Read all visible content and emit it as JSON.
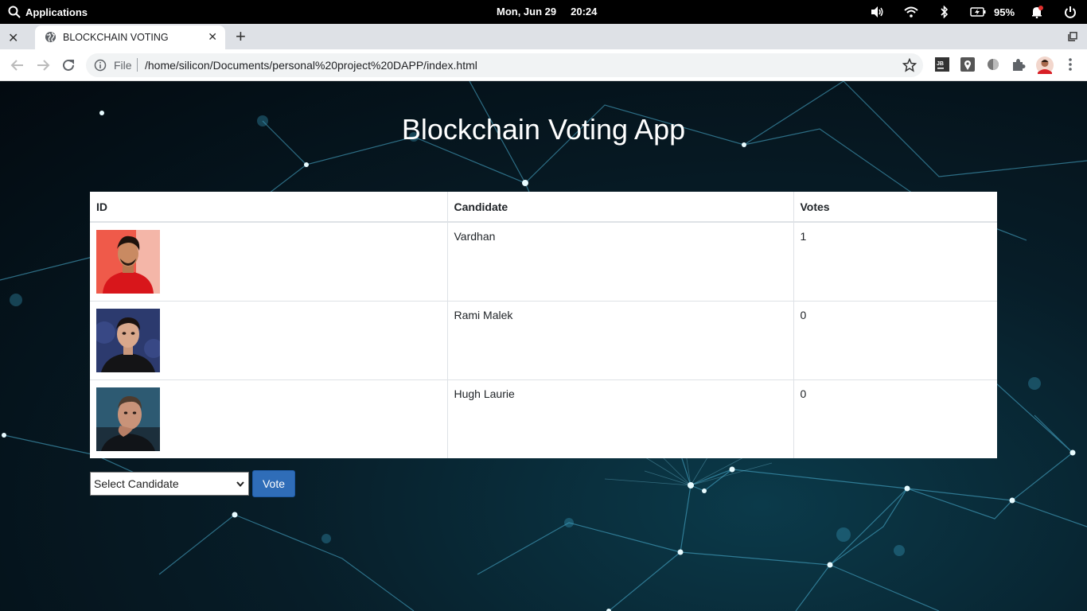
{
  "system_bar": {
    "applications_label": "Applications",
    "date": "Mon, Jun 29",
    "time": "20:24",
    "battery": "95%"
  },
  "browser": {
    "tab_title": "BLOCKCHAIN VOTING",
    "url_scheme": "File",
    "url": "/home/silicon/Documents/personal%20project%20DAPP/index.html"
  },
  "app": {
    "title": "Blockchain Voting App",
    "table": {
      "headers": [
        "ID",
        "Candidate",
        "Votes"
      ],
      "rows": [
        {
          "name": "Vardhan",
          "votes": "1"
        },
        {
          "name": "Rami Malek",
          "votes": "0"
        },
        {
          "name": "Hugh Laurie",
          "votes": "0"
        }
      ]
    },
    "select_value": "Select Candidate",
    "vote_button": "Vote"
  },
  "colors": {
    "page_background": "#071d28",
    "vote_button": "#2f6db8",
    "system_bar": "#000000"
  }
}
